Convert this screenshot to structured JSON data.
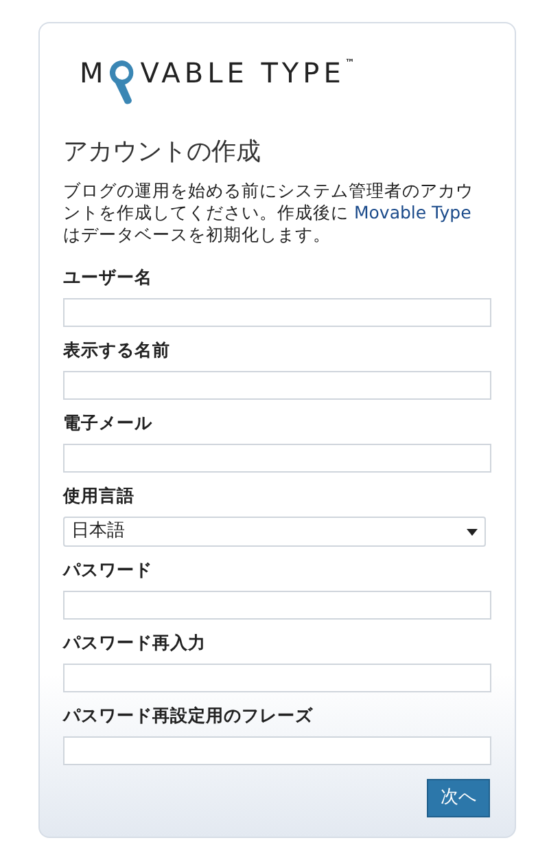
{
  "logo": {
    "before": "M",
    "after": "VABLE TYPE",
    "mark": "™"
  },
  "title": "アカウントの作成",
  "description": {
    "before": "ブログの運用を始める前にシステム管理者のアカウントを作成してください。作成後に ",
    "link": "Movable Type",
    "after": " はデータベースを初期化します。"
  },
  "fields": [
    {
      "kind": "text",
      "label": "ユーザー名"
    },
    {
      "kind": "text",
      "label": "表示する名前"
    },
    {
      "kind": "text",
      "label": "電子メール"
    },
    {
      "kind": "select",
      "label": "使用言語",
      "value": "日本語"
    },
    {
      "kind": "text",
      "label": "パスワード"
    },
    {
      "kind": "text",
      "label": "パスワード再入力"
    },
    {
      "kind": "text",
      "label": "パスワード再設定用のフレーズ"
    }
  ],
  "button": "次へ"
}
